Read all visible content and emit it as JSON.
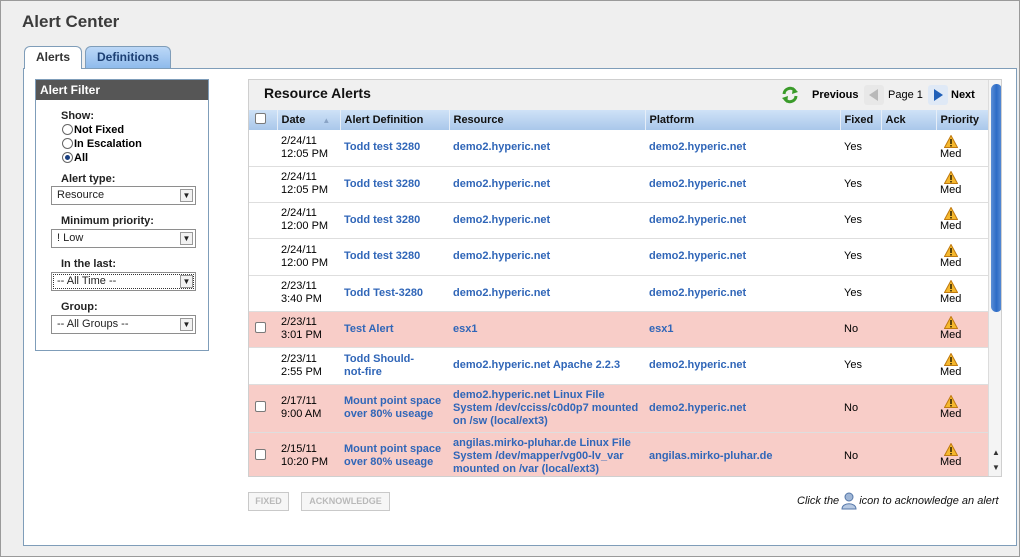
{
  "page": {
    "title": "Alert Center"
  },
  "tabs": [
    {
      "label": "Alerts"
    },
    {
      "label": "Definitions"
    }
  ],
  "filter": {
    "header": "Alert Filter",
    "show_label": "Show:",
    "show_options": [
      "Not Fixed",
      "In Escalation",
      "All"
    ],
    "show_selected": "All",
    "alert_type": {
      "label": "Alert type:",
      "value": "Resource"
    },
    "min_priority": {
      "label": "Minimum priority:",
      "value": "! Low"
    },
    "in_last": {
      "label": "In the last:",
      "value": "-- All Time --"
    },
    "group": {
      "label": "Group:",
      "value": "-- All Groups --"
    }
  },
  "alerts": {
    "title": "Resource Alerts",
    "pager": {
      "previous": "Previous",
      "page": "Page 1",
      "next": "Next"
    },
    "columns": [
      "Date",
      "Alert Definition",
      "Resource",
      "Platform",
      "Fixed",
      "Ack",
      "Priority"
    ],
    "rows": [
      {
        "date": "2/24/11",
        "time": "12:05 PM",
        "def1": "Todd test 3280",
        "def2": "",
        "res1": "demo2.hyperic.net",
        "res2": "",
        "res3": "",
        "platform": "demo2.hyperic.net",
        "fixed": "Yes",
        "priority": "Med",
        "highlight": false,
        "checkbox": false
      },
      {
        "date": "2/24/11",
        "time": "12:05 PM",
        "def1": "Todd test 3280",
        "def2": "",
        "res1": "demo2.hyperic.net",
        "res2": "",
        "res3": "",
        "platform": "demo2.hyperic.net",
        "fixed": "Yes",
        "priority": "Med",
        "highlight": false,
        "checkbox": false
      },
      {
        "date": "2/24/11",
        "time": "12:00 PM",
        "def1": "Todd test 3280",
        "def2": "",
        "res1": "demo2.hyperic.net",
        "res2": "",
        "res3": "",
        "platform": "demo2.hyperic.net",
        "fixed": "Yes",
        "priority": "Med",
        "highlight": false,
        "checkbox": false
      },
      {
        "date": "2/24/11",
        "time": "12:00 PM",
        "def1": "Todd test 3280",
        "def2": "",
        "res1": "demo2.hyperic.net",
        "res2": "",
        "res3": "",
        "platform": "demo2.hyperic.net",
        "fixed": "Yes",
        "priority": "Med",
        "highlight": false,
        "checkbox": false
      },
      {
        "date": "2/23/11",
        "time": "3:40 PM",
        "def1": "Todd Test-3280",
        "def2": "",
        "res1": "demo2.hyperic.net",
        "res2": "",
        "res3": "",
        "platform": "demo2.hyperic.net",
        "fixed": "Yes",
        "priority": "Med",
        "highlight": false,
        "checkbox": false
      },
      {
        "date": "2/23/11",
        "time": "3:01 PM",
        "def1": "Test Alert",
        "def2": "",
        "res1": "esx1",
        "res2": "",
        "res3": "",
        "platform": "esx1",
        "fixed": "No",
        "priority": "Med",
        "highlight": true,
        "checkbox": true
      },
      {
        "date": "2/23/11",
        "time": "2:55 PM",
        "def1": "Todd Should-",
        "def2": "not-fire",
        "res1": "demo2.hyperic.net Apache 2.2.3",
        "res2": "",
        "res3": "",
        "platform": "demo2.hyperic.net",
        "fixed": "Yes",
        "priority": "Med",
        "highlight": false,
        "checkbox": false
      },
      {
        "date": "2/17/11",
        "time": "9:00 AM",
        "def1": "Mount point space",
        "def2": "over 80% useage",
        "res1": "demo2.hyperic.net Linux File",
        "res2": "System /dev/cciss/c0d0p7 mounted",
        "res3": "on /sw (local/ext3)",
        "platform": "demo2.hyperic.net",
        "fixed": "No",
        "priority": "Med",
        "highlight": true,
        "checkbox": true
      },
      {
        "date": "2/15/11",
        "time": "10:20 PM",
        "def1": "Mount point space",
        "def2": "over 80% useage",
        "res1": "angilas.mirko-pluhar.de Linux File",
        "res2": "System /dev/mapper/vg00-lv_var",
        "res3": "mounted on /var (local/ext3)",
        "platform": "angilas.mirko-pluhar.de",
        "fixed": "No",
        "priority": "Med",
        "highlight": true,
        "checkbox": true
      }
    ]
  },
  "buttons": {
    "fixed": "FIXED",
    "acknowledge": "ACKNOWLEDGE"
  },
  "ack_note": {
    "before": "Click the",
    "after": "icon to acknowledge an alert"
  },
  "colors": {
    "pink_row": "#f8cdc8",
    "link": "#3066b8",
    "header_gradient_top": "#cfe2f7",
    "header_gradient_bottom": "#a9c7ea"
  }
}
